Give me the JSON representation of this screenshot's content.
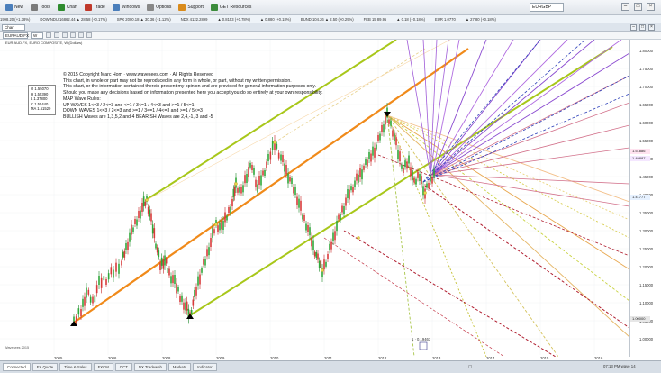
{
  "toolbar": {
    "items": [
      {
        "label": "New",
        "icon": "new-icon",
        "color": "#4a7ebb"
      },
      {
        "label": "Tools",
        "icon": "tools-icon",
        "color": "#7a7a7a"
      },
      {
        "label": "Chart",
        "icon": "chart-icon",
        "color": "#2e8b2e"
      },
      {
        "label": "Trade",
        "icon": "trade-icon",
        "color": "#c0392b"
      },
      {
        "label": "Windows",
        "icon": "windows-icon",
        "color": "#4a7ebb"
      },
      {
        "label": "Options",
        "icon": "options-icon",
        "color": "#888888"
      },
      {
        "label": "Support",
        "icon": "support-icon",
        "color": "#d98b1c"
      },
      {
        "label": "GET Resources",
        "icon": "resources-icon",
        "color": "#3c8c3c"
      }
    ],
    "search_value": "EURGBP"
  },
  "ticker": [
    "1998.20 (+1.38%)",
    "DOWINDU 16862.44 ▲ 28.58 (+0.17%)",
    "SPX 2000.18 ▲ 30.36 (+1.12%)",
    "NDX 4122.2899",
    "▲ 0.8153 (+0.78%)",
    "▲ 0.880 (+0.18%)",
    "BUND 104.26 ▲ 2.50 (+0.29%)",
    "FEB 15 89.95",
    "▲ 0.18 (+0.18%)",
    "EUR 1.0770",
    "▲ 27.80 (+0.18%)"
  ],
  "chart_tab": "Chart",
  "chart_toolbar": {
    "symbol": "EURAUD.FX",
    "timeframe": "W"
  },
  "chart": {
    "title": "EUR.AUD.FX, EURO COMPOSITE, W (Dollars)",
    "info_lines": [
      "© 2015 Copyright Marc Hom · www.wavesees.com · All Rights Reserved",
      "This chart, in whole or part may not be reproduced in any form in whole, or part, without my written permission.",
      "This chart, or the information contained therein present my opinion and are provided for general information purposes only.",
      "Should you make any decisions based on information presented here you accept you do so entirely at your own responsibility.",
      "",
      "MAP Wave Rules:",
      "UP WAVES     1<=3  /  2<=3 and <=1  /  3<=1  /  4<=3 and >=1  /  5<=1",
      "DOWN WAVES   1<=3  /  2<=3 and >=1  /  3<=1  /  4<=3 and >=1  /  5<=3",
      "BULLISH Waves are 1,3,5,2 and 4    BEARISH Waves are 2,4,-1,-3 and -5"
    ],
    "ohlc": [
      "O 1.55070",
      "H 1.55390",
      "L 1.37800",
      "C 1.55440",
      "MA 1.51520"
    ],
    "yaxis_labels": [
      "1.80000",
      "1.75000",
      "1.70000",
      "1.65000",
      "1.60000",
      "1.55000",
      "1.50000",
      "1.45000",
      "1.40000",
      "1.35000",
      "1.30000",
      "1.25000",
      "1.20000",
      "1.15000",
      "1.10000",
      "1.05000",
      "1.00000"
    ],
    "price_tags": [
      {
        "text": "1.51886",
        "color": "#ffe3f0"
      },
      {
        "text": "1.49887",
        "color": "#f4e7ff"
      },
      {
        "text": "1.41777",
        "color": "#e6f1ff"
      },
      {
        "text": "1.00000",
        "color": "#e7e7e7"
      }
    ],
    "xaxis_labels": [
      "2005",
      "2006",
      "2008",
      "2009",
      "2010",
      "2011",
      "2012",
      "2013",
      "2014",
      "2015",
      "2016"
    ],
    "footer": "Wavesees 2015",
    "bottom_mark": "1 · 0.19463"
  },
  "bottom_tabs": [
    "Connected",
    "FX Quote",
    "Time & Sales",
    "FXCM",
    "OCT",
    "DX Tradeweb",
    "Markets",
    "Indicator"
  ],
  "status": {
    "left": "Connected",
    "right": "07:13 PM  wave 14"
  }
}
